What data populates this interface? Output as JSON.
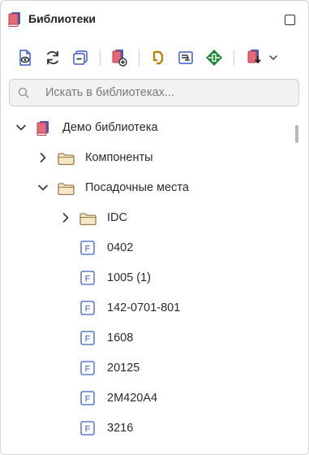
{
  "panel": {
    "title": "Библиотеки",
    "title_icon": "library-book-icon",
    "maximize_icon": "maximize-icon"
  },
  "toolbar": {
    "buttons": [
      {
        "name": "view-document-button",
        "icon": "document-eye-icon"
      },
      {
        "name": "refresh-button",
        "icon": "refresh-icon"
      },
      {
        "name": "collapse-all-button",
        "icon": "collapse-icon"
      },
      {
        "name": "add-library-button",
        "icon": "library-add-icon"
      },
      {
        "name": "symbol-editor-button",
        "icon": "symbol-icon"
      },
      {
        "name": "schematic-button",
        "icon": "schematic-icon"
      },
      {
        "name": "footprint-button",
        "icon": "footprint-icon"
      },
      {
        "name": "import-button",
        "icon": "import-library-icon"
      }
    ],
    "dropdown_icon": "chevron-down-icon"
  },
  "search": {
    "placeholder": "Искать в библиотеках...",
    "value": "",
    "icon": "search-icon"
  },
  "tree": [
    {
      "label": "Демо библиотека",
      "type": "library",
      "expanded": true,
      "level": 0
    },
    {
      "label": "Компоненты",
      "type": "folder",
      "expanded": false,
      "level": 1
    },
    {
      "label": "Посадочные места",
      "type": "folder",
      "expanded": true,
      "level": 1
    },
    {
      "label": "IDC",
      "type": "folder",
      "expanded": false,
      "level": 2
    },
    {
      "label": "0402",
      "type": "footprint",
      "level": 2
    },
    {
      "label": "1005 (1)",
      "type": "footprint",
      "level": 2
    },
    {
      "label": "142-0701-801",
      "type": "footprint",
      "level": 2
    },
    {
      "label": "1608",
      "type": "footprint",
      "level": 2
    },
    {
      "label": "20125",
      "type": "footprint",
      "level": 2
    },
    {
      "label": "2M420A4",
      "type": "footprint",
      "level": 2
    },
    {
      "label": "3216",
      "type": "footprint",
      "level": 2
    }
  ],
  "colors": {
    "library_red": "#d94a5a",
    "library_blue": "#3b5fc9",
    "folder_fill": "#f6e7c4",
    "folder_stroke": "#9a7b4a",
    "footprint_blue": "#3b5fc9",
    "symbol_gold": "#b8860b",
    "footprint_green": "#1e8a3c"
  }
}
